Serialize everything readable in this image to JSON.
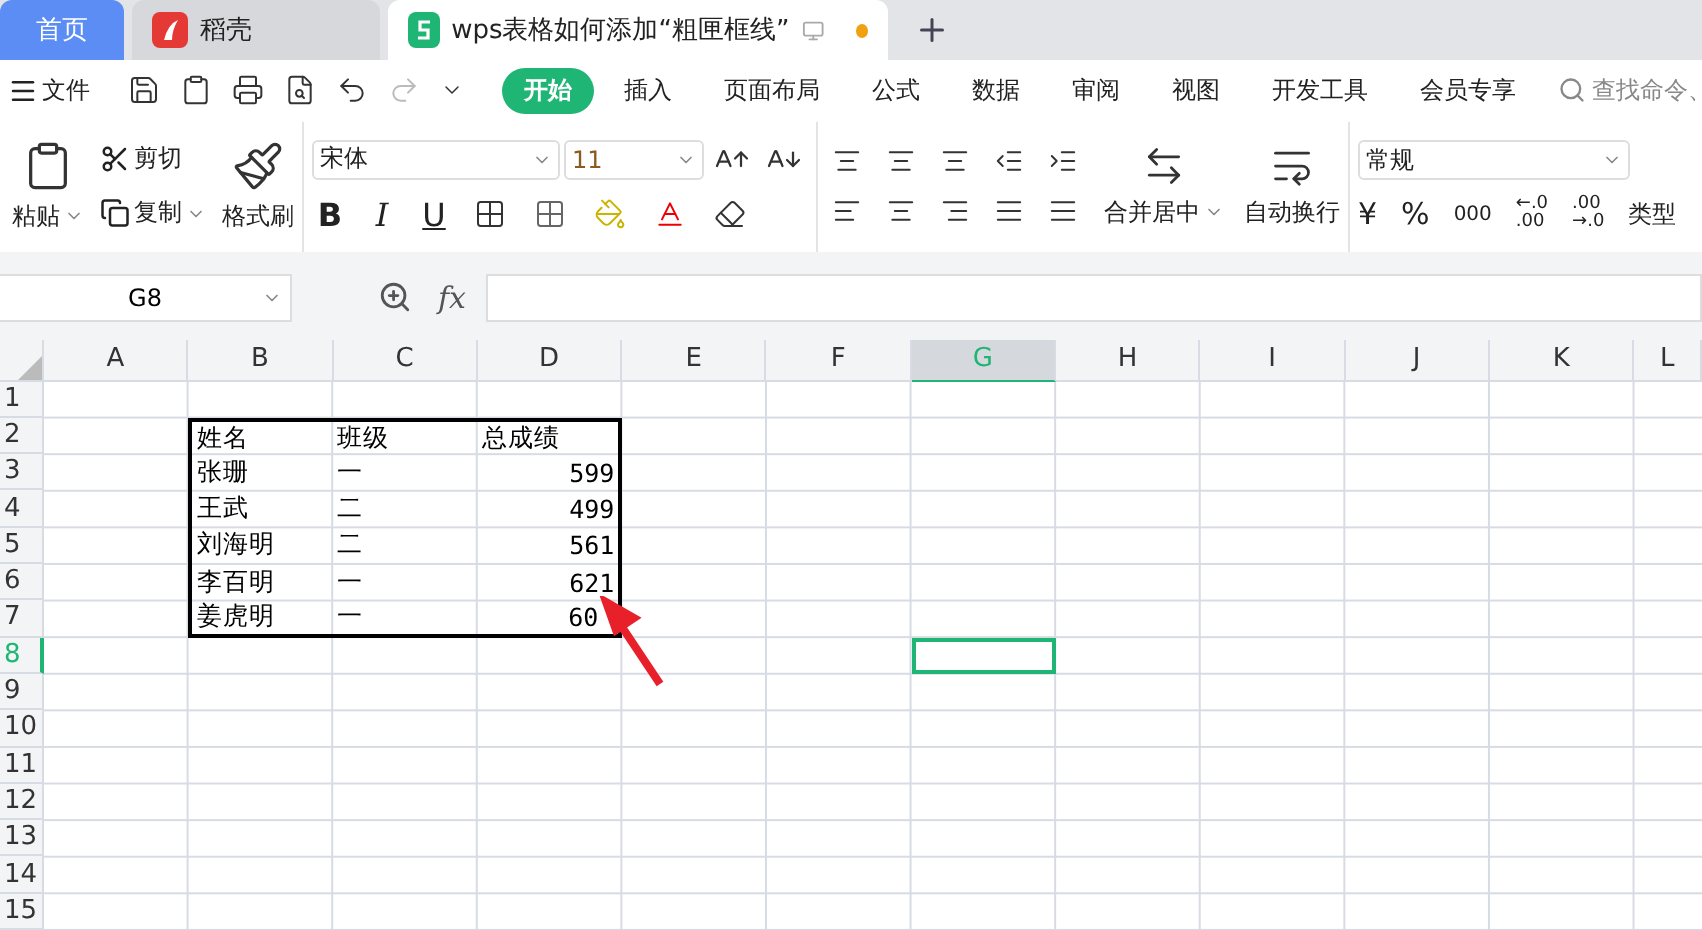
{
  "tabs": [
    {
      "kind": "home",
      "label": "首页",
      "selected": false
    },
    {
      "kind": "app",
      "label": "稻壳",
      "selected": false
    },
    {
      "kind": "doc",
      "label": "wps表格如何添加“粗匣框线”",
      "selected": true,
      "unsaved": true
    }
  ],
  "menu": {
    "file": "文件",
    "items": [
      {
        "label": "开始",
        "selected": true
      },
      {
        "label": "插入",
        "selected": false
      },
      {
        "label": "页面布局",
        "selected": false
      },
      {
        "label": "公式",
        "selected": false
      },
      {
        "label": "数据",
        "selected": false
      },
      {
        "label": "审阅",
        "selected": false
      },
      {
        "label": "视图",
        "selected": false
      },
      {
        "label": "开发工具",
        "selected": false
      },
      {
        "label": "会员专享",
        "selected": false
      }
    ],
    "search_placeholder": "查找命令、"
  },
  "ribbon": {
    "paste": "粘贴",
    "cut": "剪切",
    "copy": "复制",
    "format_painter": "格式刷",
    "font": "宋体",
    "font_size": "11",
    "bold": "B",
    "italic": "I",
    "underline": "U",
    "merge": "合并居中",
    "wrap": "自动换行",
    "number_format": "常规",
    "currency": "¥",
    "percent": "%",
    "thousands": "000",
    "increase_decimal": [
      "←.0",
      ".00"
    ],
    "decrease_decimal": [
      ".00",
      "→.0"
    ],
    "type": "类型"
  },
  "formula_bar": {
    "cell": "G8",
    "fx": "fx"
  },
  "sheet": {
    "columns": [
      {
        "label": "A",
        "selected": false
      },
      {
        "label": "B",
        "selected": false
      },
      {
        "label": "C",
        "selected": false
      },
      {
        "label": "D",
        "selected": false
      },
      {
        "label": "E",
        "selected": false
      },
      {
        "label": "F",
        "selected": false
      },
      {
        "label": "G",
        "selected": true
      },
      {
        "label": "H",
        "selected": false
      },
      {
        "label": "I",
        "selected": false
      },
      {
        "label": "J",
        "selected": false
      },
      {
        "label": "K",
        "selected": false
      },
      {
        "label": "L",
        "selected": false
      }
    ],
    "rows": [
      {
        "label": "1",
        "selected": false
      },
      {
        "label": "2",
        "selected": false
      },
      {
        "label": "3",
        "selected": false
      },
      {
        "label": "4",
        "selected": false
      },
      {
        "label": "5",
        "selected": false
      },
      {
        "label": "6",
        "selected": false
      },
      {
        "label": "7",
        "selected": false
      },
      {
        "label": "8",
        "selected": true
      },
      {
        "label": "9",
        "selected": false
      },
      {
        "label": "10",
        "selected": false
      },
      {
        "label": "11",
        "selected": false
      },
      {
        "label": "12",
        "selected": false
      },
      {
        "label": "13",
        "selected": false
      },
      {
        "label": "14",
        "selected": false
      },
      {
        "label": "15",
        "selected": false
      }
    ],
    "table": {
      "rows": [
        {
          "cells": [
            {
              "text": "姓名",
              "kind": "text"
            },
            {
              "text": "班级",
              "kind": "text"
            },
            {
              "text": "总成绩",
              "kind": "text"
            }
          ]
        },
        {
          "cells": [
            {
              "text": "张珊",
              "kind": "text"
            },
            {
              "text": "一",
              "kind": "text"
            },
            {
              "text": "599",
              "kind": "number"
            }
          ]
        },
        {
          "cells": [
            {
              "text": "王武",
              "kind": "text"
            },
            {
              "text": "二",
              "kind": "text"
            },
            {
              "text": "499",
              "kind": "number"
            }
          ]
        },
        {
          "cells": [
            {
              "text": "刘海明",
              "kind": "text"
            },
            {
              "text": "二",
              "kind": "text"
            },
            {
              "text": "561",
              "kind": "number"
            }
          ]
        },
        {
          "cells": [
            {
              "text": "李百明",
              "kind": "text"
            },
            {
              "text": "一",
              "kind": "text"
            },
            {
              "text": "621",
              "kind": "number"
            }
          ]
        },
        {
          "cells": [
            {
              "text": "姜虎明",
              "kind": "text"
            },
            {
              "text": "一",
              "kind": "text"
            },
            {
              "text": "60",
              "kind": "number"
            }
          ]
        }
      ]
    }
  }
}
